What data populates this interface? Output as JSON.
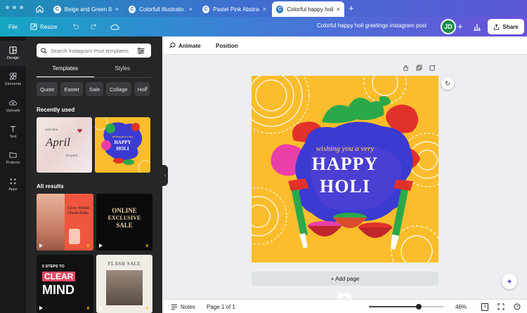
{
  "browser": {
    "tabs": [
      {
        "label": "Beige and Green Ill...",
        "favicon": "C",
        "active": false
      },
      {
        "label": "Colorfull Illustrativ...",
        "favicon": "C",
        "active": false
      },
      {
        "label": "Pastel Pink Abstrac...",
        "favicon": "C",
        "active": false
      },
      {
        "label": "Colorful happy holi...",
        "favicon": "C",
        "active": true
      }
    ],
    "close_glyph": "×",
    "new_tab_glyph": "+"
  },
  "toolbar": {
    "file_label": "File",
    "resize_label": "Resize",
    "design_title": "Colorful happy holi greetings instagram post",
    "avatar_initials": "JD",
    "share_label": "Share"
  },
  "rail": {
    "items": [
      {
        "label": "Design",
        "icon": "layout-icon",
        "active": true
      },
      {
        "label": "Elements",
        "icon": "shapes-icon",
        "active": false
      },
      {
        "label": "Uploads",
        "icon": "cloud-upload-icon",
        "active": false
      },
      {
        "label": "Text",
        "icon": "text-icon",
        "active": false
      },
      {
        "label": "Projects",
        "icon": "folder-icon",
        "active": false
      },
      {
        "label": "Apps",
        "icon": "apps-grid-icon",
        "active": false
      }
    ]
  },
  "panel": {
    "search_placeholder": "Search Instagram Post templates",
    "tabs": [
      "Templates",
      "Styles"
    ],
    "active_tab": "Templates",
    "chips": [
      "Quote",
      "Easter",
      "Sale",
      "Collage",
      "Holi"
    ],
    "recently_used_heading": "Recently used",
    "all_results_heading": "All results",
    "recent": [
      {
        "line1": "welcome",
        "line2": "April",
        "line3": "be good"
      },
      {
        "line1": "wishing you a very",
        "line2": "HAPPY",
        "line3": "HOLI"
      }
    ],
    "results": [
      {
        "text": "Glow Within Cheek Balm"
      },
      {
        "line1": "ONLINE",
        "line2": "EXCLUSIVE",
        "line3": "SALE"
      },
      {
        "line1": "5 STEPS TO",
        "line2": "CLEAR",
        "line3": "MIND"
      },
      {
        "text": "FLASH SALE"
      }
    ]
  },
  "context_bar": {
    "animate_label": "Animate",
    "position_label": "Position"
  },
  "design": {
    "wishing": "wishing you a very",
    "happy": "HAPPY",
    "holi": "HOLI",
    "colors": {
      "bg": "#fbbd2b",
      "blob": "#3b3bd1",
      "pink": "#ea3fa8",
      "green": "#2aa84a",
      "red": "#e0312b"
    }
  },
  "canvas": {
    "add_page_label": "+ Add page"
  },
  "bottom": {
    "notes_label": "Notes",
    "page_label": "Page 1 of 1",
    "zoom_label": "46%",
    "zoom_fraction": 0.46,
    "page_count_badge": "1"
  }
}
